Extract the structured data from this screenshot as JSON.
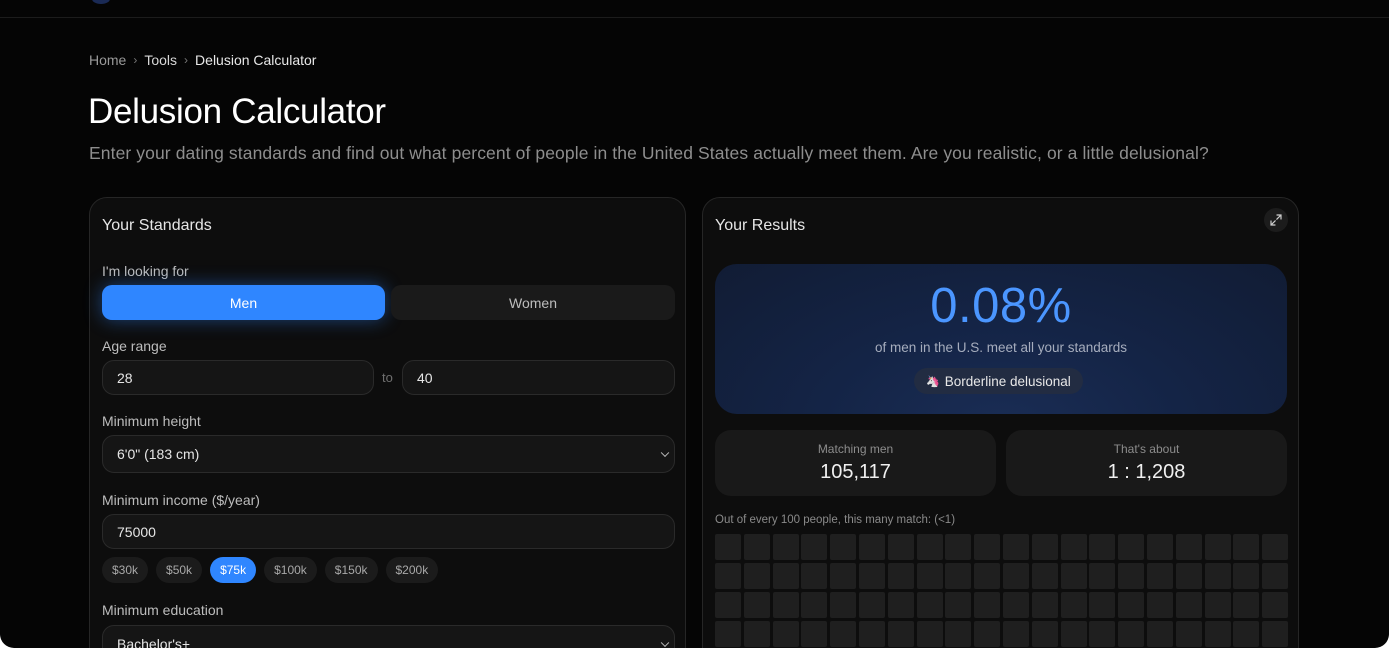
{
  "breadcrumb": {
    "home": "Home",
    "tools": "Tools",
    "current": "Delusion Calculator"
  },
  "page": {
    "title": "Delusion Calculator",
    "subtitle": "Enter your dating standards and find out what percent of people in the United States actually meet them. Are you realistic, or a little delusional?"
  },
  "standards": {
    "title": "Your Standards",
    "looking_for_label": "I'm looking for",
    "options": [
      "Men",
      "Women"
    ],
    "selected": "Men",
    "age_label": "Age range",
    "age_min": "28",
    "age_to": "to",
    "age_max": "40",
    "height_label": "Minimum height",
    "height_value": "6'0\" (183 cm)",
    "income_label": "Minimum income ($/year)",
    "income_value": "75000",
    "income_chips": [
      "$30k",
      "$50k",
      "$75k",
      "$100k",
      "$150k",
      "$200k"
    ],
    "income_chip_selected": "$75k",
    "education_label": "Minimum education",
    "education_value": "Bachelor's+"
  },
  "results": {
    "title": "Your Results",
    "percent": "0.08%",
    "caption": "of men in the U.S. meet all your standards",
    "verdict_emoji": "🦄",
    "verdict": "Borderline delusional",
    "matching_label": "Matching men",
    "matching_value": "105,117",
    "ratio_label": "That's about",
    "ratio_value": "1 : 1,208",
    "grid_caption": "Out of every 100 people, this many match: (<1)",
    "grid_matches": 0
  },
  "colors": {
    "accent": "#2f86ff",
    "result_value": "#4b96ff",
    "background": "#050505"
  }
}
